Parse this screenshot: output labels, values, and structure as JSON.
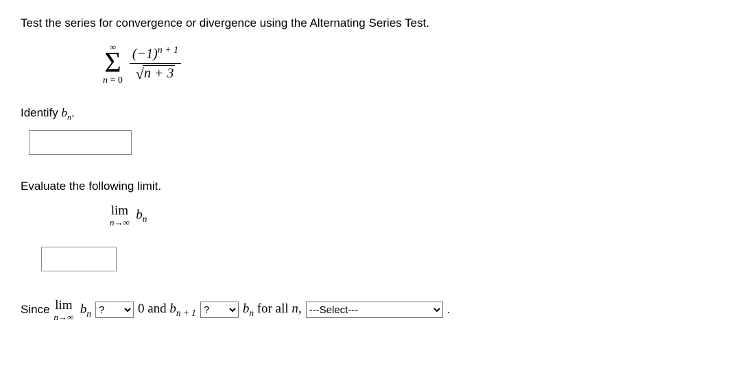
{
  "question": {
    "prompt": "Test the series for convergence or divergence using the Alternating Series Test."
  },
  "formula": {
    "sigma_upper": "∞",
    "sigma_lower": "n = 0",
    "numerator_base": "(−1)",
    "numerator_exp": "n + 1",
    "denom_inside_sqrt": "n + 3"
  },
  "identify": {
    "label_pre": "Identify ",
    "var": "b",
    "var_sub": "n",
    "label_post": "."
  },
  "input1_value": "",
  "evaluate": {
    "text": "Evaluate the following limit."
  },
  "limit": {
    "lim": "lim",
    "under": "n→∞",
    "var": "b",
    "var_sub": "n"
  },
  "input2_value": "",
  "conclusion": {
    "since": "Since",
    "lim": "lim",
    "lim_under": "n→∞",
    "bn_var": "b",
    "bn_sub": "n",
    "select1_placeholder": "?",
    "zero_and": "0 and ",
    "bnp1_var": "b",
    "bnp1_sub": "n + 1",
    "select2_placeholder": "?",
    "bn2_var": "b",
    "bn2_sub": "n",
    "for_all_n": " for all ",
    "n_var": "n",
    "comma": ", ",
    "select3_placeholder": "---Select---",
    "period": "."
  }
}
